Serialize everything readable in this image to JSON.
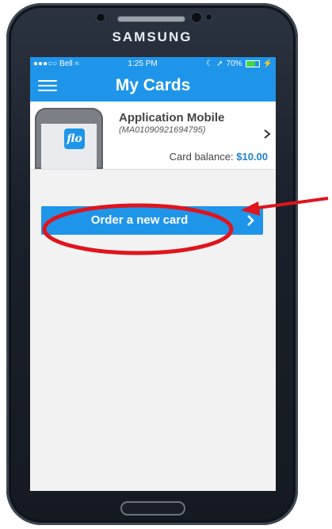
{
  "device": {
    "brand": "SAMSUNG"
  },
  "status_bar": {
    "carrier": "●●●○○ Bell",
    "wifi_icon": "wifi-icon",
    "time": "1:25 PM",
    "battery": "70%",
    "icons": [
      "moon-icon",
      "location-arrow-icon",
      "battery-icon",
      "charging-icon"
    ]
  },
  "app_bar": {
    "menu_icon": "hamburger-menu-icon",
    "title": "My Cards"
  },
  "card": {
    "name": "Application Mobile",
    "id": "(MA01090921694795)",
    "balance_label": "Card balance:",
    "balance_value": "$10.00",
    "logo_text": "flo"
  },
  "order_button": {
    "label": "Order a new card",
    "icon": "chevron-right-icon"
  },
  "colors": {
    "accent": "#1f95ea",
    "annotation_red": "#e0141c"
  }
}
